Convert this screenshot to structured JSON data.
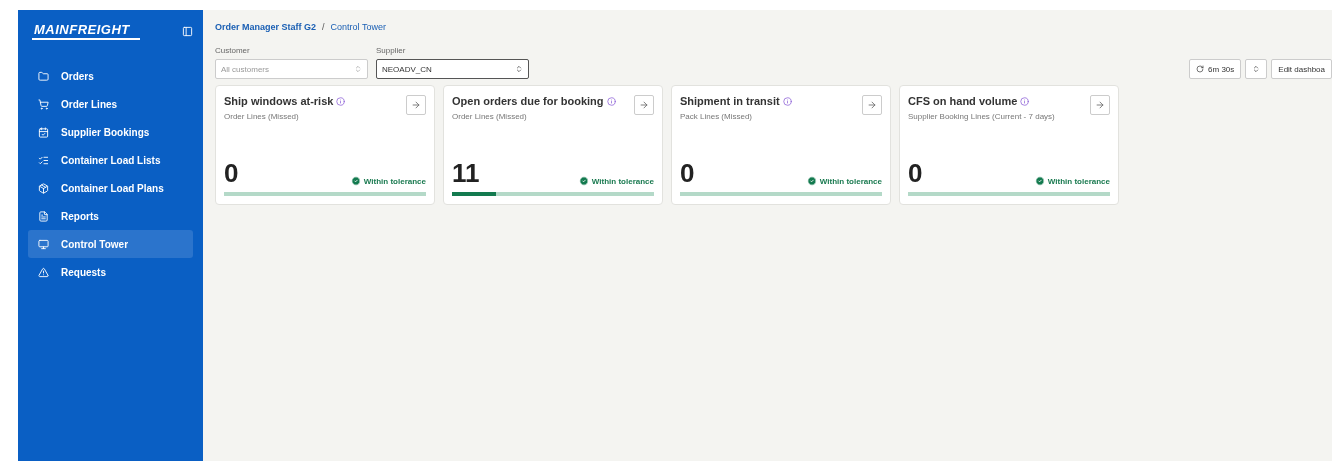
{
  "sidebar": {
    "logo": "MAINFREIGHT",
    "items": [
      {
        "label": "Orders",
        "selected": false
      },
      {
        "label": "Order Lines",
        "selected": false
      },
      {
        "label": "Supplier Bookings",
        "selected": false
      },
      {
        "label": "Container Load Lists",
        "selected": false
      },
      {
        "label": "Container Load Plans",
        "selected": false
      },
      {
        "label": "Reports",
        "selected": false
      },
      {
        "label": "Control Tower",
        "selected": true
      },
      {
        "label": "Requests",
        "selected": false
      }
    ]
  },
  "breadcrumb": {
    "parent": "Order Manager Staff G2",
    "separator": "/",
    "current": "Control Tower"
  },
  "filters": [
    {
      "label": "Customer",
      "placeholder": "All customers",
      "focused": false
    },
    {
      "label": "Supplier",
      "value": "NEOADV_CN",
      "focused": true
    }
  ],
  "refresh": {
    "interval": "6m 30s"
  },
  "edit_button": "Edit dashboa",
  "cards": [
    {
      "title": "Ship windows at-risk",
      "subtitle": "Order Lines (Missed)",
      "value": "0",
      "status": "Within tolerance"
    },
    {
      "title": "Open orders due for booking",
      "subtitle": "Order Lines (Missed)",
      "value": "11",
      "status": "Within tolerance",
      "level": 0.22
    },
    {
      "title": "Shipment in transit",
      "subtitle": "Pack Lines (Missed)",
      "value": "0",
      "status": "Within tolerance"
    },
    {
      "title": "CFS on hand volume",
      "subtitle": "Supplier Booking Lines (Current - 7 days)",
      "value": "0",
      "status": "Within tolerance"
    }
  ]
}
